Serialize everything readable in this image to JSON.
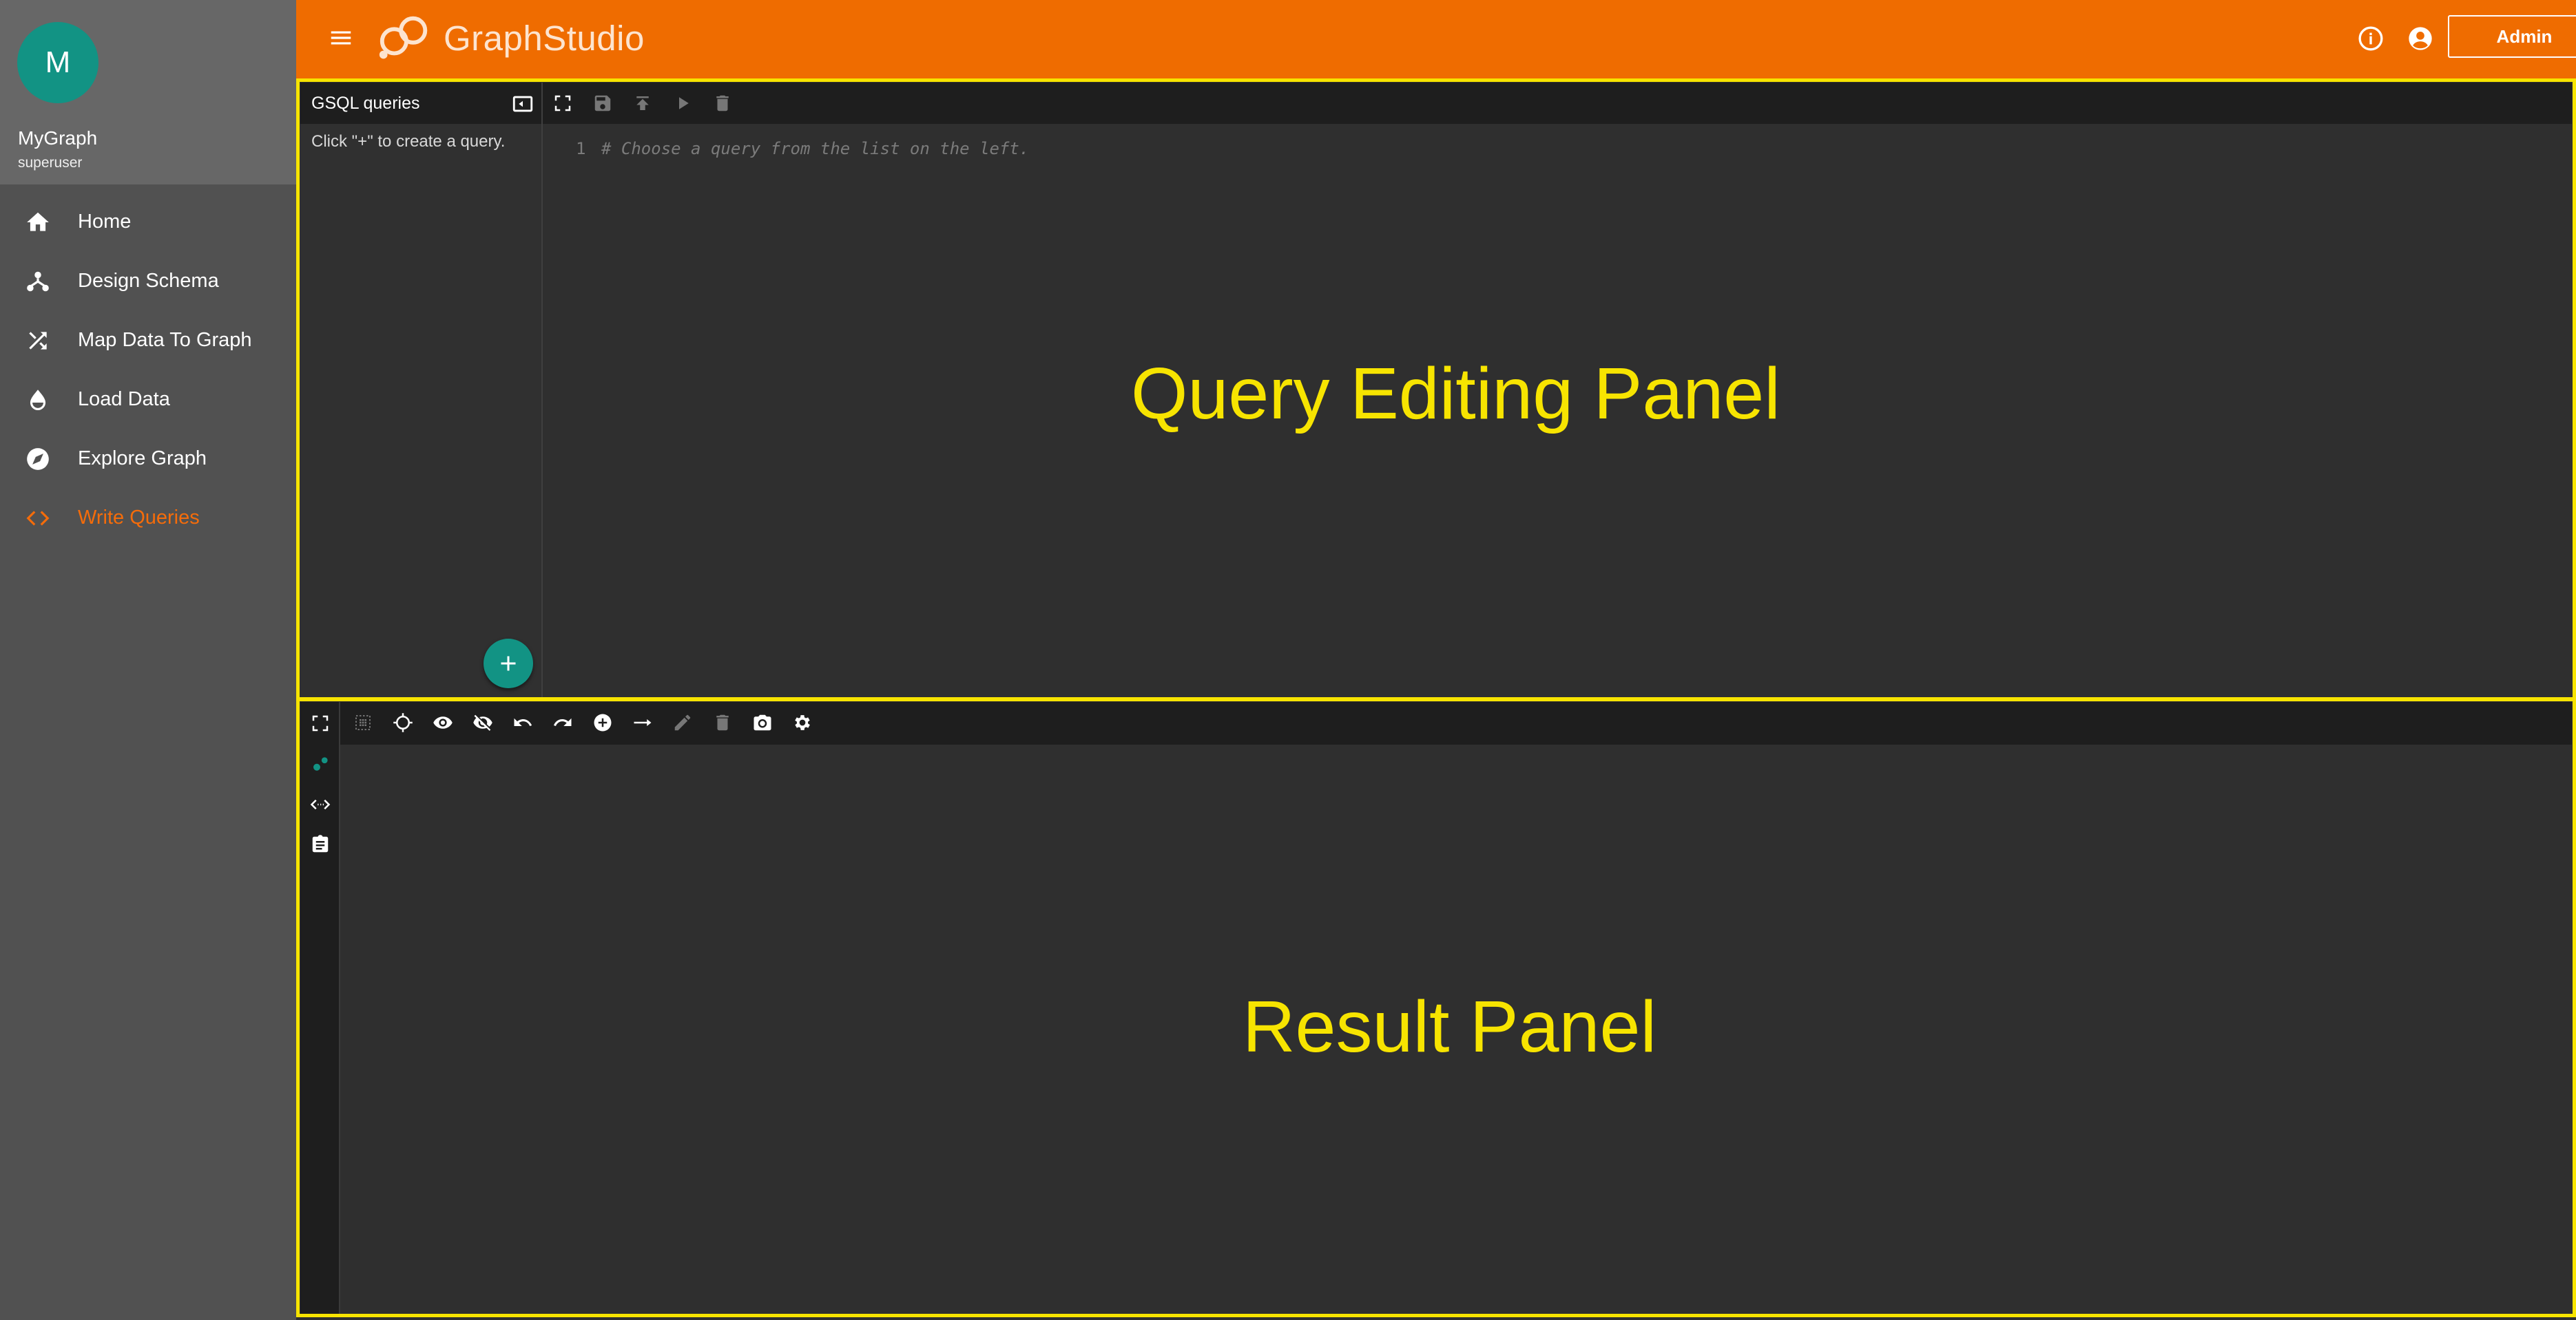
{
  "app": {
    "name_part1": "Graph",
    "name_part2": "Studio",
    "admin_label": "Admin"
  },
  "profile": {
    "initial": "M",
    "graph": "MyGraph",
    "role": "superuser"
  },
  "nav": [
    {
      "label": "Home",
      "icon": "home-icon"
    },
    {
      "label": "Design Schema",
      "icon": "schema-icon"
    },
    {
      "label": "Map Data To Graph",
      "icon": "shuffle-icon"
    },
    {
      "label": "Load Data",
      "icon": "drop-icon"
    },
    {
      "label": "Explore Graph",
      "icon": "compass-icon"
    },
    {
      "label": "Write Queries",
      "icon": "code-icon",
      "active": true
    }
  ],
  "queries": {
    "title": "GSQL queries",
    "empty_hint": "Click \"+\" to create a query."
  },
  "editor": {
    "line_number": "1",
    "placeholder": "# Choose a query from the list on the left."
  },
  "annotations": {
    "query_panel": "Query Editing Panel",
    "result_panel": "Result Panel"
  },
  "colors": {
    "topbar": "#ef6c00",
    "accent": "#129384",
    "highlight": "#f7e400",
    "active_nav": "#f56c0a"
  }
}
